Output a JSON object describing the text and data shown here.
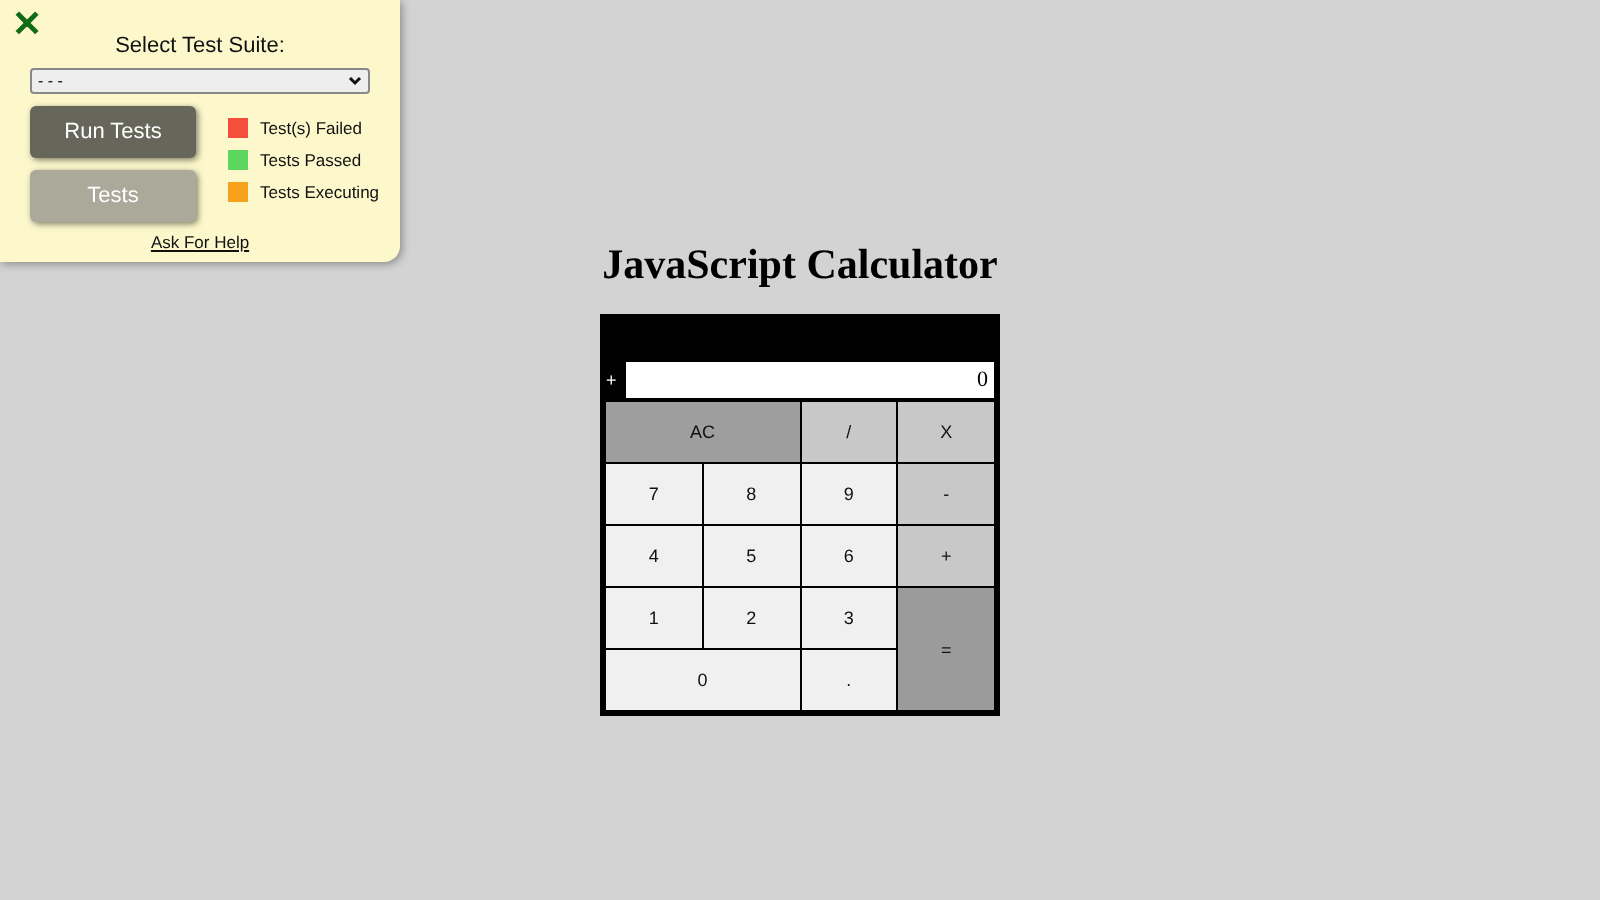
{
  "test_panel": {
    "close": "✕",
    "title": "Select Test Suite:",
    "suite_select": {
      "value": "- - -"
    },
    "buttons": [
      {
        "label": "Run Tests",
        "kind": "primary"
      },
      {
        "label": "Tests",
        "kind": "secondary"
      }
    ],
    "legend": [
      {
        "label": "Test(s) Failed",
        "color": "#f44f3c"
      },
      {
        "label": "Tests Passed",
        "color": "#5cd65c"
      },
      {
        "label": "Tests Executing",
        "color": "#f7a01c"
      }
    ],
    "help_link": "Ask For Help"
  },
  "heading": "JavaScript Calculator",
  "calculator": {
    "sign": "+",
    "display": "0",
    "keys": [
      {
        "label": "AC",
        "kind": "clear"
      },
      {
        "label": "/",
        "kind": "operator"
      },
      {
        "label": "X",
        "kind": "operator"
      },
      {
        "label": "7",
        "kind": "digit"
      },
      {
        "label": "8",
        "kind": "digit"
      },
      {
        "label": "9",
        "kind": "digit"
      },
      {
        "label": "-",
        "kind": "operator"
      },
      {
        "label": "4",
        "kind": "digit"
      },
      {
        "label": "5",
        "kind": "digit"
      },
      {
        "label": "6",
        "kind": "digit"
      },
      {
        "label": "+",
        "kind": "operator"
      },
      {
        "label": "1",
        "kind": "digit"
      },
      {
        "label": "2",
        "kind": "digit"
      },
      {
        "label": "3",
        "kind": "digit"
      },
      {
        "label": "=",
        "kind": "equals"
      },
      {
        "label": "0",
        "kind": "digit"
      },
      {
        "label": ".",
        "kind": "digit"
      }
    ]
  }
}
